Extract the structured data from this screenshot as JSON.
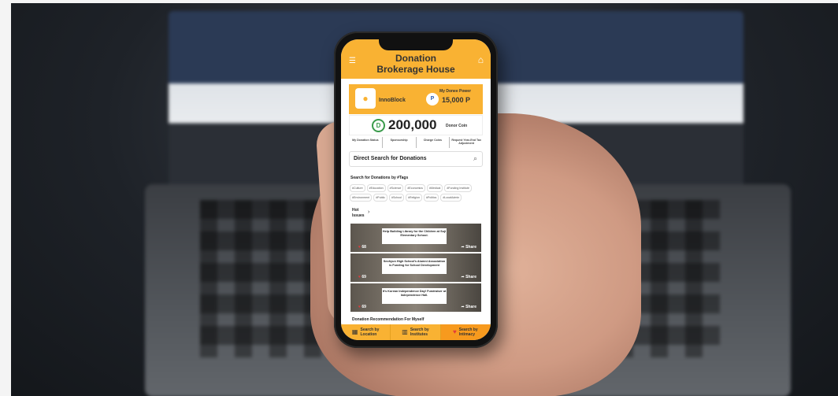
{
  "app": {
    "title_line1": "Donation",
    "title_line2": "Brokerage House"
  },
  "icons": {
    "menu": "menu-icon",
    "home": "home-icon",
    "search": "search-icon"
  },
  "profile": {
    "user_name": "InnoBlock",
    "power_label": "My Donee Power",
    "power_value": "15,000 P",
    "power_icon_letter": "P"
  },
  "coin": {
    "value": "200,000",
    "label": "Donor Coin",
    "icon_letter": "D"
  },
  "actions": [
    "My Donation Status",
    "Sponsorship",
    "Charge Coins",
    "Request Year-End Tax Adjustment"
  ],
  "search": {
    "label": "Direct Search for Donations"
  },
  "tags": {
    "title": "Search for Donations by #Tags",
    "items": [
      "#Culture",
      "#Education",
      "#Science",
      "#Economics",
      "#Medical",
      "#Funding Institute",
      "#Environment",
      "#Public",
      "#School",
      "#Religion",
      "#Politics",
      "#LocalAdmin"
    ]
  },
  "hot": {
    "title": "Hot Issues"
  },
  "cards": [
    {
      "text": "Help Building Library for the Children at Suji Elementary School.",
      "likes": "68",
      "share": "Share"
    },
    {
      "text": "Seohyun High School's Alumni Association is Funding for School Development",
      "likes": "69",
      "share": "Share"
    },
    {
      "text": "It's Korean Independence Day! Fundraiser at Independence Hall.",
      "likes": "69",
      "share": "Share"
    }
  ],
  "recommendation": {
    "title": "Donation Recommendation For Myself"
  },
  "bottom_nav": [
    {
      "label_line1": "Search by",
      "label_line2": "Location",
      "icon": "map-icon"
    },
    {
      "label_line1": "Search by",
      "label_line2": "Institutes",
      "icon": "building-icon"
    },
    {
      "label_line1": "Search by",
      "label_line2": "Intimacy",
      "icon": "heart-icon"
    }
  ],
  "colors": {
    "accent": "#f9b233",
    "accent_dark": "#f79a1e",
    "heart": "#e23b3b",
    "coin_green": "#3a9b4b"
  }
}
